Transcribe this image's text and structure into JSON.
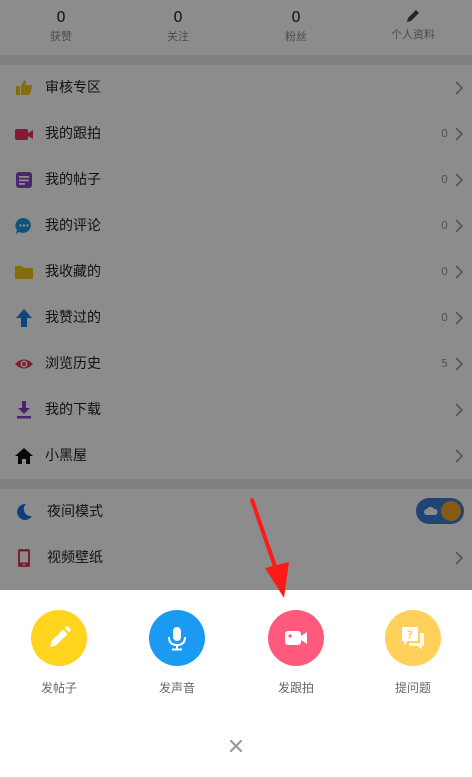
{
  "stats": [
    {
      "value": "0",
      "label": "获赞"
    },
    {
      "value": "0",
      "label": "关注"
    },
    {
      "value": "0",
      "label": "粉丝"
    },
    {
      "label": "个人资料",
      "icon": "pencil-icon"
    }
  ],
  "menu": [
    {
      "label": "审核专区",
      "icon": "thumbs-up-icon",
      "color": "#f2c617",
      "count": ""
    },
    {
      "label": "我的跟拍",
      "icon": "video-camera-icon",
      "color": "#e8345d",
      "count": "0"
    },
    {
      "label": "我的帖子",
      "icon": "post-icon",
      "color": "#8a44c9",
      "count": "0"
    },
    {
      "label": "我的评论",
      "icon": "comment-icon",
      "color": "#1a96e6",
      "count": "0"
    },
    {
      "label": "我收藏的",
      "icon": "folder-icon",
      "color": "#f2c617",
      "count": "0"
    },
    {
      "label": "我赞过的",
      "icon": "arrow-up-icon",
      "color": "#1a7fe0",
      "count": "0"
    },
    {
      "label": "浏览历史",
      "icon": "eye-icon",
      "color": "#e8345d",
      "count": "5"
    },
    {
      "label": "我的下载",
      "icon": "download-icon",
      "color": "#8a44c9",
      "count": ""
    },
    {
      "label": "小黑屋",
      "icon": "house-icon",
      "color": "#111111",
      "count": ""
    }
  ],
  "settings": [
    {
      "label": "夜间模式",
      "icon": "moon-icon",
      "color": "#1a6fe0"
    },
    {
      "label": "视频壁纸",
      "icon": "phone-icon",
      "color": "#e8345d"
    }
  ],
  "sheet": {
    "actions": [
      {
        "label": "发帖子",
        "icon": "pencil-icon",
        "color": "#ffd41c"
      },
      {
        "label": "发声音",
        "icon": "microphone-icon",
        "color": "#1a9af0"
      },
      {
        "label": "发跟拍",
        "icon": "video-camera-icon",
        "color": "#ff5a7d"
      },
      {
        "label": "提问题",
        "icon": "question-icon",
        "color": "#ffd15a"
      }
    ],
    "close_icon": "close-icon"
  }
}
